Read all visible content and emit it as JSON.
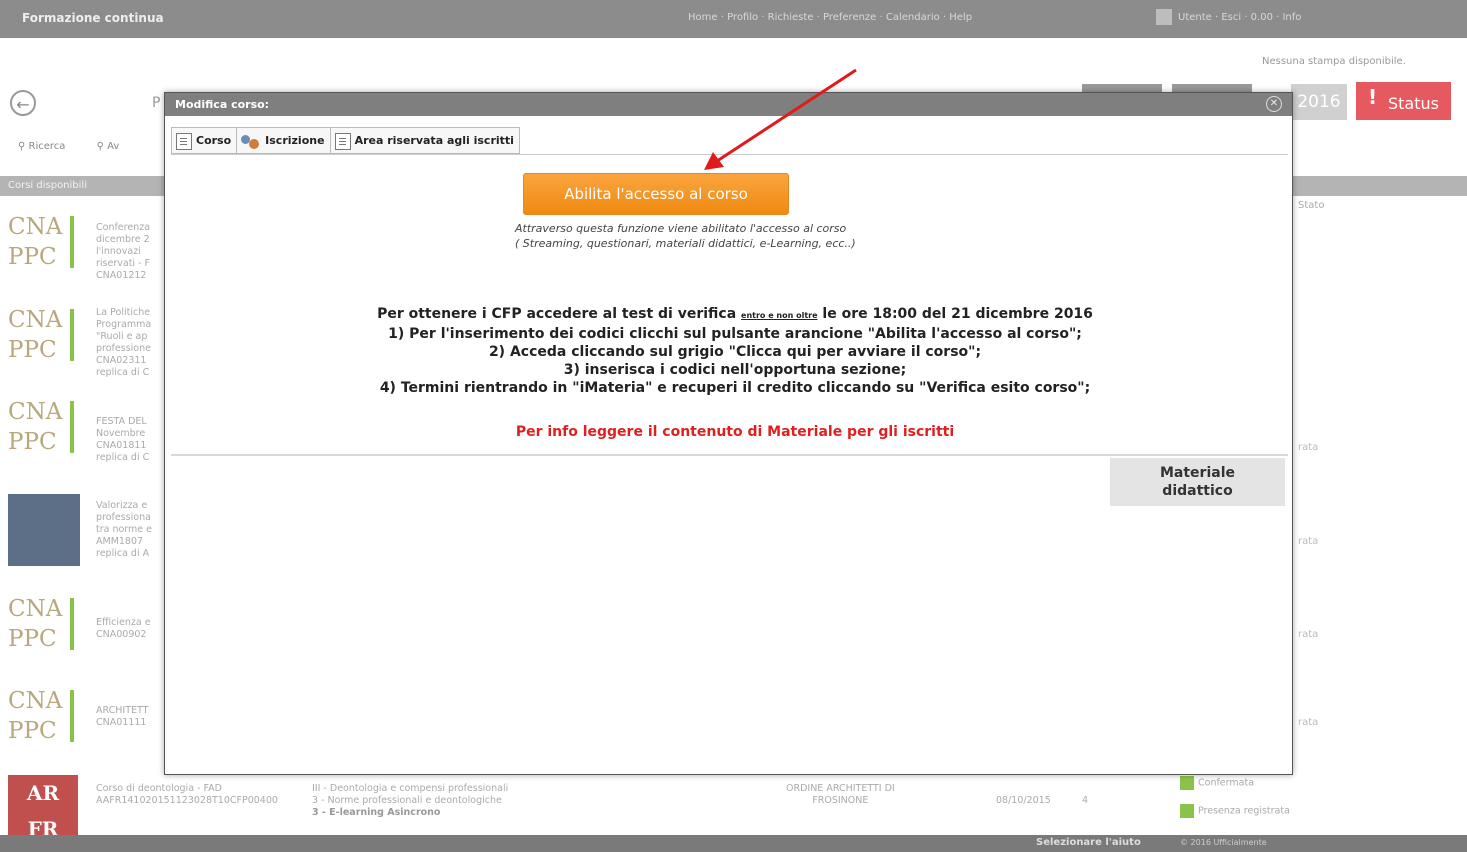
{
  "background": {
    "app_title": "Formazione continua",
    "top_links": "Home · Profilo · Richieste · Preferenze · Calendario · Help",
    "user_info": "Utente · Esci · 0.00 · Info",
    "no_print": "Nessuna stampa disponibile.",
    "page_initial": "P",
    "search_label": "Ricerca",
    "advanced_label": "Av",
    "section_label": "Corsi disponibili",
    "stato_header": "Stato",
    "year_button": "2016",
    "status_button": "Status",
    "list_rows": [
      {
        "lines": [
          "Conferenza",
          "dicembre 2",
          "l'innovazi",
          "riservati - F",
          "CNA01212"
        ]
      },
      {
        "lines": [
          "La Politiche",
          "Programma",
          "\"Ruoli e ap",
          "professione",
          "CNA02311",
          "replica di C"
        ]
      },
      {
        "lines": [
          "FESTA DEL",
          "Novembre",
          "CNA01811",
          "replica di C"
        ]
      },
      {
        "lines": [
          "Valorizza e",
          "professiona",
          "tra norme e",
          "AMM1807",
          "replica di A"
        ]
      },
      {
        "lines": [
          "Efficienza e",
          "CNA00902"
        ]
      },
      {
        "lines": [
          "ARCHITETT",
          "CNA01111"
        ]
      }
    ],
    "right_statuses": [
      "rata",
      "rata",
      "rata",
      "rata"
    ],
    "bottom_row": {
      "title": "Corso di deontologia - FAD",
      "code": "AAFR141020151123028T10CFP00400",
      "area1": "III - Deontologia e compensi professionali",
      "area2": "3 - Norme professionali e deontologiche",
      "area3": "3 - E-learning Asincrono",
      "org": "ORDINE ARCHITETTI DI",
      "org2": "FROSINONE",
      "date": "08/10/2015",
      "credits": "4",
      "status1": "Confermata",
      "status2": "Presenza registrata"
    },
    "footer_help": "Selezionare l'aiuto",
    "footer_copy": "© 2016 Ufficialmente"
  },
  "modal": {
    "title": "Modifica corso:",
    "tabs": [
      {
        "label": "Corso"
      },
      {
        "label": "Iscrizione"
      },
      {
        "label": "Area riservata agli iscritti"
      }
    ],
    "enable_button": "Abilita l'accesso al corso",
    "enable_desc_1": "Attraverso questa funzione viene abilitato l'accesso al corso",
    "enable_desc_2": "( Streaming, questionari, materiali didattici, e-Learning, ecc..)",
    "instructions": {
      "line1_a": "Per  ottenere i CFP accedere al test di verifica",
      "line1_small": "entro e non oltre",
      "line1_b": "le ore 18:00 del 21 dicembre 2016",
      "line2": "1) Per l'inserimento dei codici clicchi sul pulsante arancione \"Abilita l'accesso al corso\";",
      "line3": "2) Acceda cliccando sul grigio \"Clicca qui per avviare il corso\";",
      "line4": "3) inserisca i codici nell'opportuna sezione;",
      "line5": "4) Termini rientrando in \"iMateria\" e recuperi il credito cliccando su \"Verifica esito corso\";"
    },
    "info_red": "Per info leggere il contenuto di Materiale per gli iscritti",
    "material_button_1": "Materiale",
    "material_button_2": "didattico"
  },
  "colors": {
    "orange_button": "#f39c1f",
    "info_red": "#e02020",
    "status_red": "#e6595f",
    "arrow": "#e01b1b"
  }
}
